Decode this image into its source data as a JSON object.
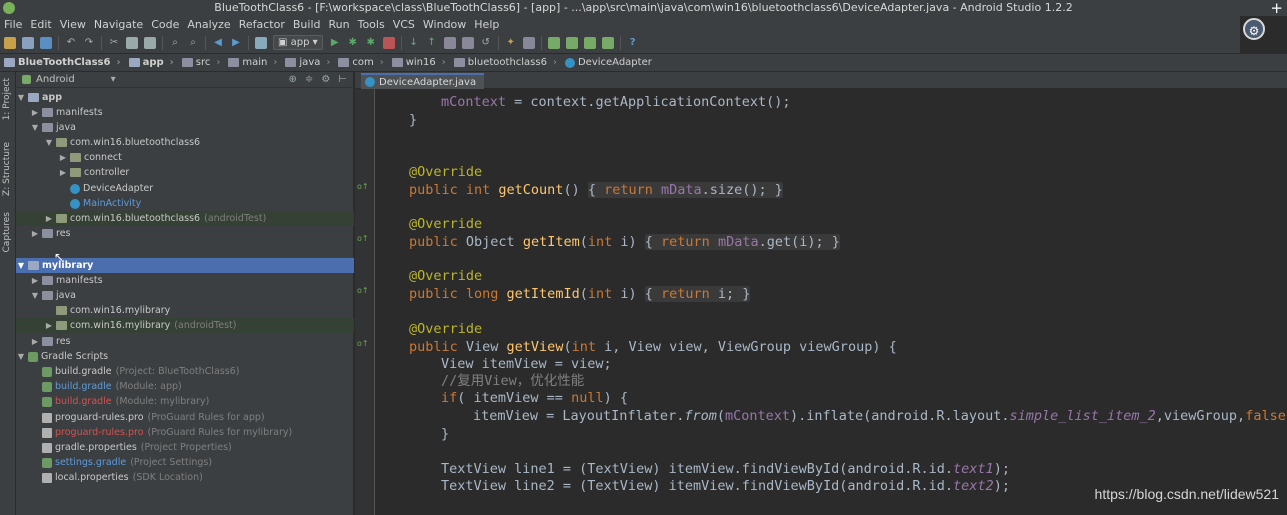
{
  "window": {
    "title": "BlueToothClass6 - [F:\\workspace\\class\\BlueToothClass6] - [app] - ...\\app\\src\\main\\java\\com\\win16\\bluetoothclass6\\DeviceAdapter.java - Android Studio 1.2.2"
  },
  "menu": [
    "File",
    "Edit",
    "View",
    "Navigate",
    "Code",
    "Analyze",
    "Refactor",
    "Build",
    "Run",
    "Tools",
    "VCS",
    "Window",
    "Help"
  ],
  "toolbar": {
    "run_config": "app"
  },
  "breadcrumb": [
    "BlueToothClass6",
    "app",
    "src",
    "main",
    "java",
    "com",
    "win16",
    "bluetoothclass6",
    "DeviceAdapter"
  ],
  "side_tabs": [
    "1: Project",
    "Z: Structure",
    "Captures"
  ],
  "project": {
    "view_mode": "Android",
    "tree": [
      {
        "label": "app",
        "hint": ""
      },
      {
        "label": "manifests",
        "hint": ""
      },
      {
        "label": "java",
        "hint": ""
      },
      {
        "label": "com.win16.bluetoothclass6",
        "hint": ""
      },
      {
        "label": "connect",
        "hint": ""
      },
      {
        "label": "controller",
        "hint": ""
      },
      {
        "label": "DeviceAdapter",
        "hint": ""
      },
      {
        "label": "MainActivity",
        "hint": ""
      },
      {
        "label": "com.win16.bluetoothclass6",
        "hint": "(androidTest)"
      },
      {
        "label": "res",
        "hint": ""
      },
      {
        "label": "mylibrary",
        "hint": ""
      },
      {
        "label": "manifests",
        "hint": ""
      },
      {
        "label": "java",
        "hint": ""
      },
      {
        "label": "com.win16.mylibrary",
        "hint": ""
      },
      {
        "label": "com.win16.mylibrary",
        "hint": "(androidTest)"
      },
      {
        "label": "res",
        "hint": ""
      },
      {
        "label": "Gradle Scripts",
        "hint": ""
      },
      {
        "label": "build.gradle",
        "hint": "(Project: BlueToothClass6)"
      },
      {
        "label": "build.gradle",
        "hint": "(Module: app)"
      },
      {
        "label": "build.gradle",
        "hint": "(Module: mylibrary)"
      },
      {
        "label": "proguard-rules.pro",
        "hint": "(ProGuard Rules for app)"
      },
      {
        "label": "proguard-rules.pro",
        "hint": "(ProGuard Rules for mylibrary)"
      },
      {
        "label": "gradle.properties",
        "hint": "(Project Properties)"
      },
      {
        "label": "settings.gradle",
        "hint": "(Project Settings)"
      },
      {
        "label": "local.properties",
        "hint": "(SDK Location)"
      }
    ]
  },
  "editor": {
    "tab": "DeviceAdapter.java",
    "lines": [
      "mContext = context.getApplicationContext();",
      "}",
      "",
      "@Override",
      "public int getCount() { return mData.size(); }",
      "",
      "@Override",
      "public Object getItem(int i) { return mData.get(i); }",
      "",
      "@Override",
      "public long getItemId(int i) { return i; }",
      "",
      "@Override",
      "public View getView(int i, View view, ViewGroup viewGroup) {",
      "View itemView = view;",
      "//复用View，优化性能",
      "if( itemView == null) {",
      "itemView = LayoutInflater.from(mContext).inflate(android.R.layout.simple_list_item_2,viewGroup,false);",
      "}",
      "",
      "TextView line1 = (TextView) itemView.findViewById(android.R.id.text1);",
      "TextView line2 = (TextView) itemView.findViewById(android.R.id.text2);"
    ]
  },
  "watermark": "https://blog.csdn.net/lidew521",
  "avatar_glyph": "⚙",
  "plus_glyph": "+"
}
